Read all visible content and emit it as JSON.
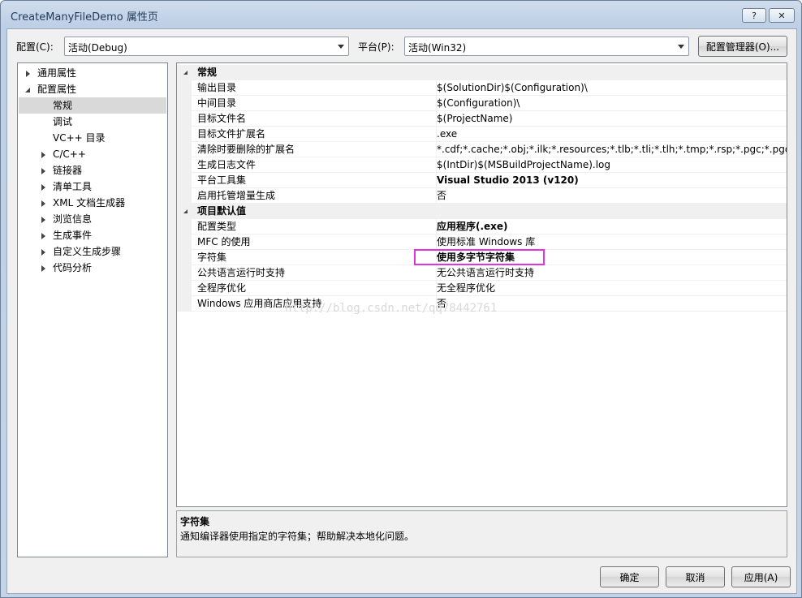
{
  "window": {
    "title": "CreateManyFileDemo 属性页",
    "help_btn": "?",
    "close_btn": "✕"
  },
  "config": {
    "label": "配置(C):",
    "value": "活动(Debug)"
  },
  "platform": {
    "label": "平台(P):",
    "value": "活动(Win32)"
  },
  "config_manager": "配置管理器(O)...",
  "tree": {
    "common": "通用属性",
    "config_props": "配置属性",
    "items": [
      "常规",
      "调试",
      "VC++ 目录",
      "C/C++",
      "链接器",
      "清单工具",
      "XML 文档生成器",
      "浏览信息",
      "生成事件",
      "自定义生成步骤",
      "代码分析"
    ]
  },
  "grid": {
    "cat1": "常规",
    "general": [
      {
        "name": "输出目录",
        "value": "$(SolutionDir)$(Configuration)\\"
      },
      {
        "name": "中间目录",
        "value": "$(Configuration)\\"
      },
      {
        "name": "目标文件名",
        "value": "$(ProjectName)"
      },
      {
        "name": "目标文件扩展名",
        "value": ".exe"
      },
      {
        "name": "清除时要删除的扩展名",
        "value": "*.cdf;*.cache;*.obj;*.ilk;*.resources;*.tlb;*.tli;*.tlh;*.tmp;*.rsp;*.pgc;*.pgd;*.meta"
      },
      {
        "name": "生成日志文件",
        "value": "$(IntDir)$(MSBuildProjectName).log"
      },
      {
        "name": "平台工具集",
        "value": "Visual Studio 2013 (v120)"
      },
      {
        "name": "启用托管增量生成",
        "value": "否"
      }
    ],
    "cat2": "项目默认值",
    "defaults": [
      {
        "name": "配置类型",
        "value": "应用程序(.exe)"
      },
      {
        "name": "MFC 的使用",
        "value": "使用标准 Windows 库"
      },
      {
        "name": "字符集",
        "value": "使用多字节字符集"
      },
      {
        "name": "公共语言运行时支持",
        "value": "无公共语言运行时支持"
      },
      {
        "name": "全程序优化",
        "value": "无全程序优化"
      },
      {
        "name": "Windows 应用商店应用支持",
        "value": "否"
      }
    ]
  },
  "watermark": "http://blog.csdn.net/qq78442761",
  "description": {
    "title": "字符集",
    "text": "通知编译器使用指定的字符集；帮助解决本地化问题。"
  },
  "buttons": {
    "ok": "确定",
    "cancel": "取消",
    "apply": "应用(A)"
  },
  "colors": {
    "highlight": "#e233e2",
    "selection": "#d9d9d9"
  }
}
